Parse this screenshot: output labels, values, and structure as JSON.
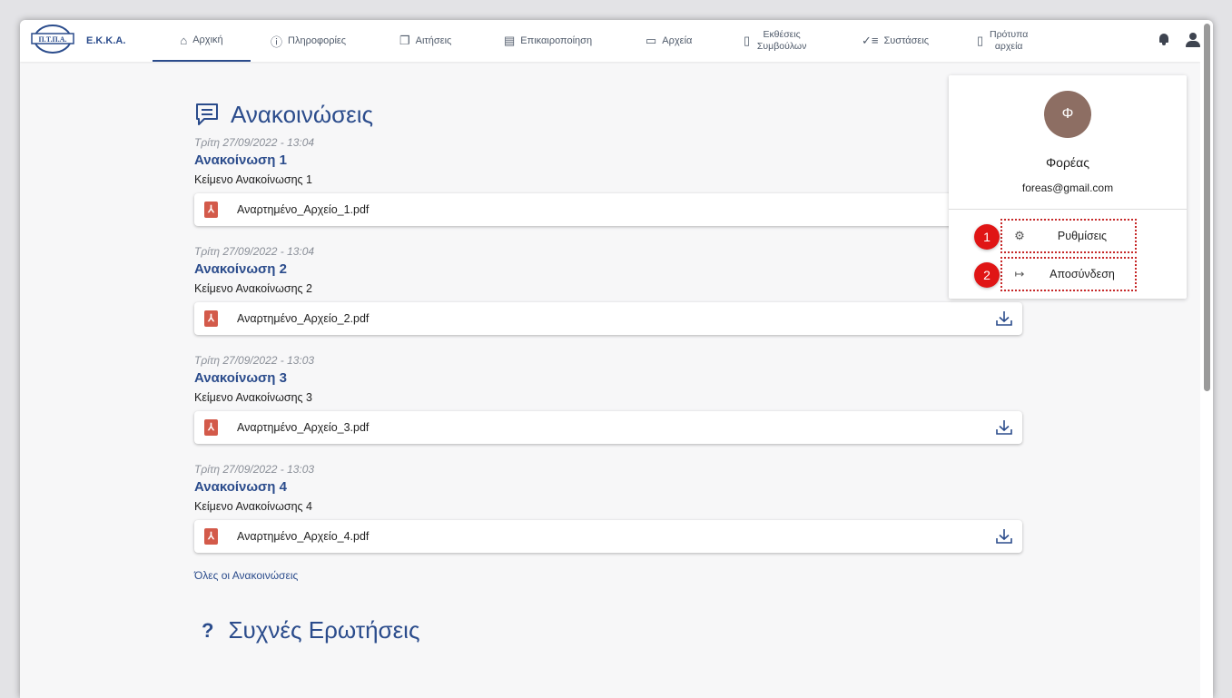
{
  "brand": {
    "logo_text": "Π.Τ.Π.Α.",
    "name": "Ε.Κ.Κ.Α."
  },
  "nav": [
    {
      "label": "Αρχική",
      "icon": "home-icon"
    },
    {
      "label": "Πληροφορίες",
      "icon": "info-icon"
    },
    {
      "label": "Αιτήσεις",
      "icon": "copy-icon"
    },
    {
      "label": "Επικαιροποίηση",
      "icon": "form-icon"
    },
    {
      "label": "Αρχεία",
      "icon": "folder-icon"
    },
    {
      "label": "Εκθέσεις Συμβούλων",
      "icon": "document-icon"
    },
    {
      "label": "Συστάσεις",
      "icon": "checklist-icon"
    },
    {
      "label": "Πρότυπα αρχεία",
      "icon": "file-icon"
    }
  ],
  "announcements": {
    "title": "Ανακοινώσεις",
    "items": [
      {
        "date": "Τρίτη 27/09/2022 - 13:04",
        "title": "Ανακοίνωση 1",
        "body": "Κείμενο Ανακοίνωσης 1",
        "file": "Αναρτημένο_Αρχείο_1.pdf"
      },
      {
        "date": "Τρίτη 27/09/2022 - 13:04",
        "title": "Ανακοίνωση 2",
        "body": "Κείμενο Ανακοίνωσης 2",
        "file": "Αναρτημένο_Αρχείο_2.pdf"
      },
      {
        "date": "Τρίτη 27/09/2022 - 13:03",
        "title": "Ανακοίνωση 3",
        "body": "Κείμενο Ανακοίνωσης 3",
        "file": "Αναρτημένο_Αρχείο_3.pdf"
      },
      {
        "date": "Τρίτη 27/09/2022 - 13:03",
        "title": "Ανακοίνωση 4",
        "body": "Κείμενο Ανακοίνωσης 4",
        "file": "Αναρτημένο_Αρχείο_4.pdf"
      }
    ],
    "all_link": "Όλες οι Ανακοινώσεις"
  },
  "faq": {
    "title": "Συχνές Ερωτήσεις"
  },
  "user_menu": {
    "initial": "Φ",
    "name": "Φορέας",
    "email": "foreas@gmail.com",
    "settings_label": "Ρυθμίσεις",
    "logout_label": "Αποσύνδεση",
    "badge_1": "1",
    "badge_2": "2"
  },
  "colors": {
    "primary": "#2b4c8c",
    "avatar": "#8d6e63",
    "badge": "#e01515",
    "pdf": "#d35a4a"
  }
}
